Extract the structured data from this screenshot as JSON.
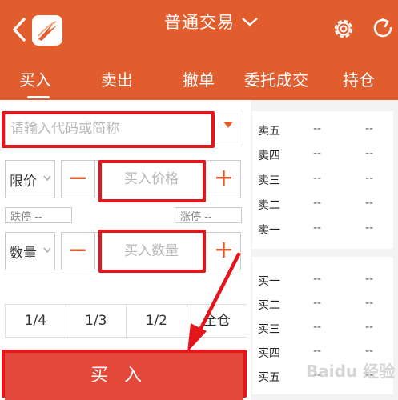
{
  "header": {
    "title": "普通交易",
    "back_icon": "chevron-left-icon",
    "settings_icon": "gear-icon",
    "refresh_icon": "refresh-icon",
    "background_color": "#e15d2d"
  },
  "tabs": [
    {
      "label": "买入",
      "active": true
    },
    {
      "label": "卖出",
      "active": false
    },
    {
      "label": "撤单",
      "active": false
    },
    {
      "label": "委托成交",
      "active": false
    },
    {
      "label": "持仓",
      "active": false
    }
  ],
  "form": {
    "code_placeholder": "请输入代码或简称",
    "price_type": "限价",
    "price_placeholder": "买入价格",
    "limit_down_label": "跌停 --",
    "limit_up_label": "涨停 --",
    "quantity_type": "数量",
    "quantity_placeholder": "买入数量",
    "minus_label": "−",
    "plus_label": "+",
    "fractions": [
      "1/4",
      "1/3",
      "1/2",
      "全仓"
    ],
    "buy_button": "买入"
  },
  "order_book": {
    "sell": [
      {
        "label": "卖五",
        "price": "--",
        "volume": "--"
      },
      {
        "label": "卖四",
        "price": "--",
        "volume": "--"
      },
      {
        "label": "卖三",
        "price": "--",
        "volume": "--"
      },
      {
        "label": "卖二",
        "price": "--",
        "volume": "--"
      },
      {
        "label": "卖一",
        "price": "--",
        "volume": "--"
      }
    ],
    "buy": [
      {
        "label": "买一",
        "price": "--",
        "volume": "--"
      },
      {
        "label": "买二",
        "price": "--",
        "volume": "--"
      },
      {
        "label": "买三",
        "price": "--",
        "volume": "--"
      },
      {
        "label": "买四",
        "price": "--",
        "volume": "--"
      },
      {
        "label": "买五",
        "price": "--",
        "volume": "--"
      }
    ]
  },
  "watermark": "Baidu 经验",
  "colors": {
    "accent": "#e15d2d",
    "buy": "#e4483b",
    "highlight": "#e4161b"
  }
}
